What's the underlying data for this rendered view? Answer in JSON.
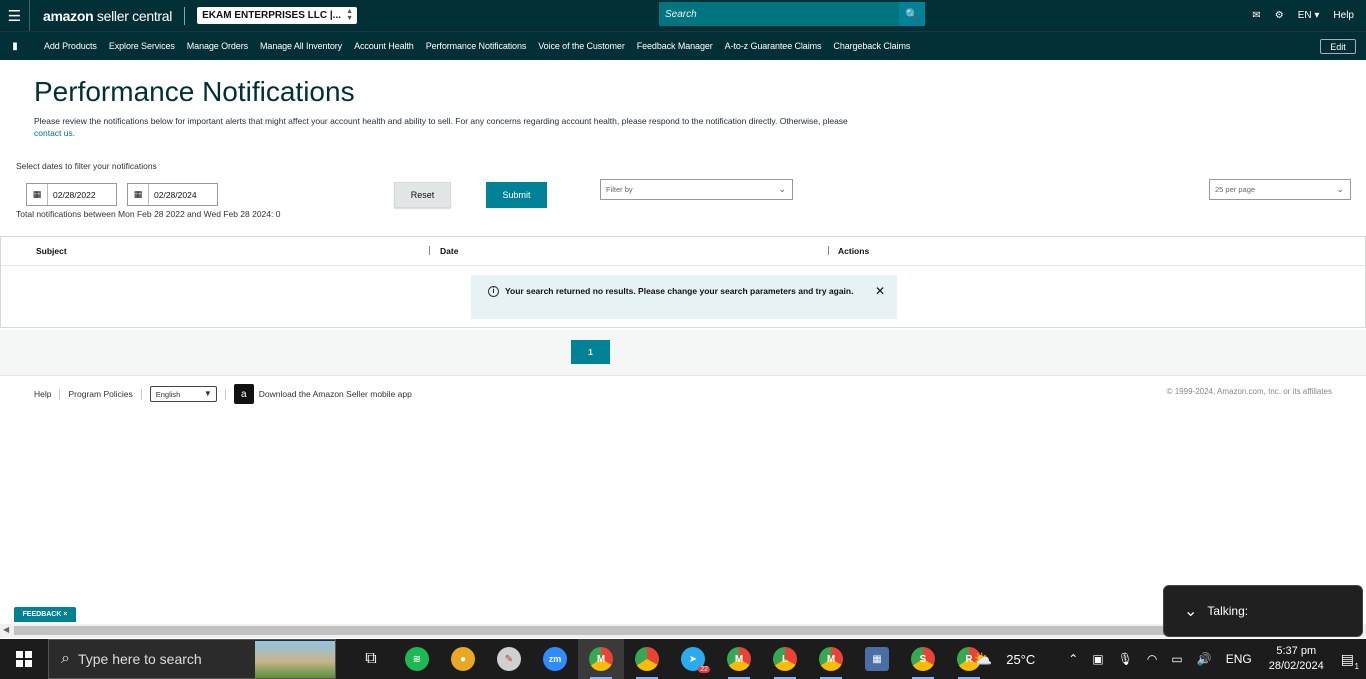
{
  "header": {
    "brand_bold": "amazon",
    "brand_sub": " seller central",
    "account": "EKAM ENTERPRISES LLC |...",
    "search_placeholder": "Search",
    "language": "EN",
    "help": "Help"
  },
  "nav": {
    "items": [
      "Add Products",
      "Explore Services",
      "Manage Orders",
      "Manage All Inventory",
      "Account Health",
      "Performance Notifications",
      "Voice of the Customer",
      "Feedback Manager",
      "A-to-z Guarantee Claims",
      "Chargeback Claims"
    ],
    "edit": "Edit"
  },
  "page": {
    "title": "Performance Notifications",
    "description": "Please review the notifications below for important alerts that might affect your account health and ability to sell. For any concerns regarding account health, please respond to the notification directly. Otherwise, please",
    "contact_link": "contact us."
  },
  "filters": {
    "label": "Select dates to filter your notifications",
    "date_from": "02/28/2022",
    "date_to": "02/28/2024",
    "total": "Total notifications between Mon Feb 28 2022 and Wed Feb 28 2024: 0",
    "reset": "Reset",
    "submit": "Submit",
    "filter_by": "Filter by",
    "per_page": "25 per page"
  },
  "table": {
    "columns": [
      "Subject",
      "Date",
      "Actions"
    ],
    "empty_message": "Your search returned no results. Please change your search parameters and try again."
  },
  "pagination": {
    "current": "1"
  },
  "footer": {
    "help": "Help",
    "policies": "Program Policies",
    "language": "English",
    "app_download": "Download the Amazon Seller mobile app",
    "copyright": "© 1999-2024, Amazon.com, Inc. or its affiliates"
  },
  "overlays": {
    "feedback": "FEEDBACK ×",
    "talking": "Talking:"
  },
  "taskbar": {
    "search": "Type here to search",
    "weather": "25°C",
    "lang": "ENG",
    "time": "5:37 pm",
    "date": "28/02/2024",
    "telegram_badge": "22",
    "notification_count": "1",
    "chrome_profiles": [
      "M",
      "",
      "M",
      "L",
      "M",
      "S",
      "R"
    ]
  }
}
